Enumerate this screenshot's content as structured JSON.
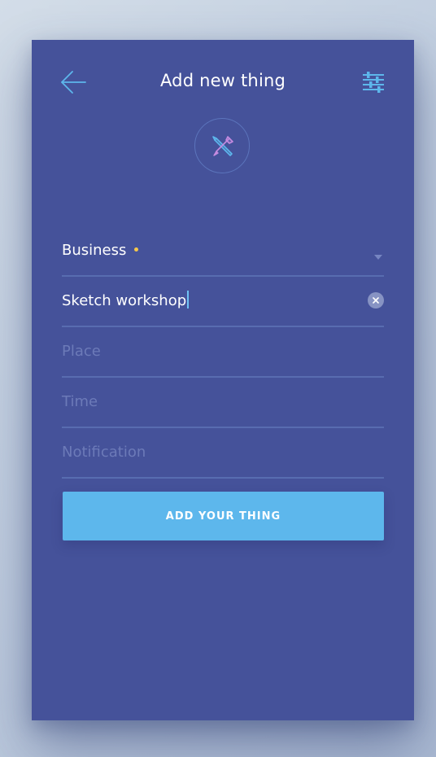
{
  "header": {
    "title": "Add new thing",
    "back_icon": "arrow-left-icon",
    "filter_icon": "sliders-icon"
  },
  "logo": {
    "icon": "pencil-brush-crossed-icon"
  },
  "form": {
    "category": {
      "value": "Business",
      "dot_color": "#f7c84a",
      "icon": "chevron-down-icon"
    },
    "name": {
      "value": "Sketch workshop",
      "clear_icon": "clear-x-icon"
    },
    "place": {
      "placeholder": "Place"
    },
    "time": {
      "placeholder": "Time"
    },
    "notification": {
      "placeholder": "Notification"
    }
  },
  "submit": {
    "label": "ADD YOUR THING"
  },
  "colors": {
    "background": "#45529a",
    "accent": "#5db7ec",
    "highlight": "#f7c84a"
  }
}
